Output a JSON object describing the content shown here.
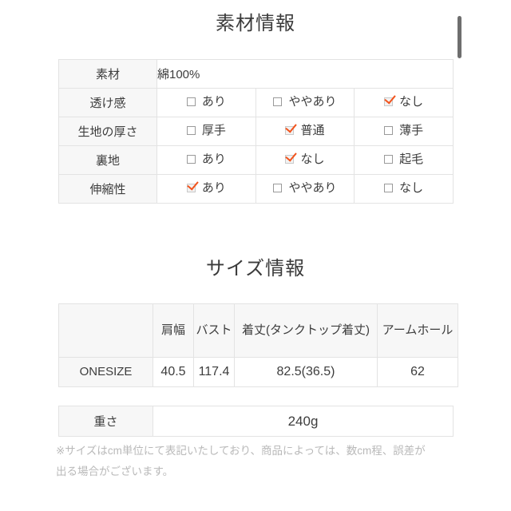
{
  "material": {
    "title": "素材情報",
    "rows": [
      {
        "label": "素材",
        "type": "text",
        "value": "綿100%",
        "value_color": "#ef6aa0"
      },
      {
        "label": "透け感",
        "type": "options",
        "options": [
          {
            "text": "あり",
            "checked": false
          },
          {
            "text": "ややあり",
            "checked": false
          },
          {
            "text": "なし",
            "checked": true
          }
        ]
      },
      {
        "label": "生地の厚さ",
        "type": "options",
        "options": [
          {
            "text": "厚手",
            "checked": false
          },
          {
            "text": "普通",
            "checked": true
          },
          {
            "text": "薄手",
            "checked": false
          }
        ]
      },
      {
        "label": "裏地",
        "type": "options",
        "options": [
          {
            "text": "あり",
            "checked": false
          },
          {
            "text": "なし",
            "checked": true
          },
          {
            "text": "起毛",
            "checked": false
          }
        ]
      },
      {
        "label": "伸縮性",
        "type": "options",
        "options": [
          {
            "text": "あり",
            "checked": true
          },
          {
            "text": "ややあり",
            "checked": false
          },
          {
            "text": "なし",
            "checked": false
          }
        ]
      }
    ]
  },
  "size": {
    "title": "サイズ情報",
    "headers": [
      "",
      "肩幅",
      "バスト",
      "着丈(タンクトップ着丈)",
      "アームホール"
    ],
    "rows": [
      [
        "ONESIZE",
        "40.5",
        "117.4",
        "82.5(36.5)",
        "62"
      ]
    ]
  },
  "weight": {
    "label": "重さ",
    "value": "240g"
  },
  "note": {
    "line1": "※サイズはcm単位にて表記いたしており、商品によっては、数cm程、誤差が",
    "line2": "出る場合がございます。"
  },
  "colors": {
    "accent_pink": "#ef6aa0",
    "check_orange": "#f2531c",
    "header_gray": "#f7f7f7",
    "border_gray": "#e3e3e3",
    "text": "#3d3d3d",
    "note_gray": "#b9b9b9"
  },
  "scrollbar": {
    "name": "vertical-scrollbar"
  }
}
